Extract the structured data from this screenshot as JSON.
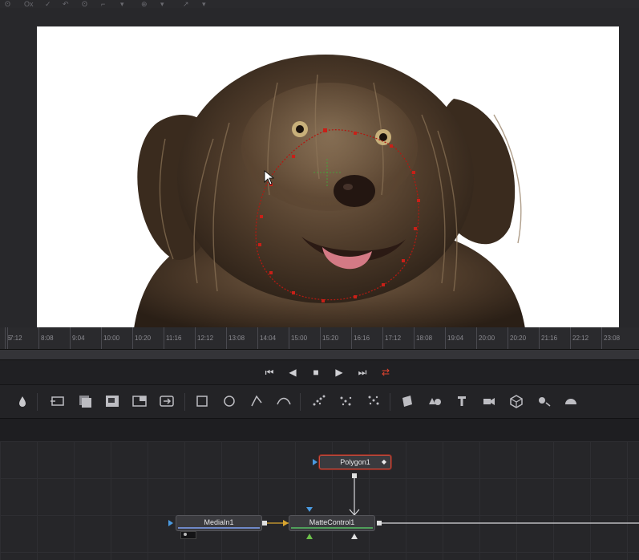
{
  "viewer": {
    "top_icons": [
      "ʘ",
      "Ox",
      "✓",
      "↶",
      "ʘ",
      "⌐",
      "▾",
      "⊕",
      "▾",
      "↗",
      "▾"
    ]
  },
  "ruler": {
    "ticks": [
      "6",
      "7:12",
      "8:08",
      "9:04",
      "10:00",
      "10:20",
      "11:16",
      "12:12",
      "13:08",
      "14:04",
      "15:00",
      "15:20",
      "16:16",
      "17:12",
      "18:08",
      "19:04",
      "20:00",
      "20:20",
      "21:16",
      "22:12",
      "23:08"
    ]
  },
  "transport": {
    "first": "⏮",
    "prev": "◀",
    "stop": "■",
    "play": "▶",
    "last": "⏭",
    "loop": "⇄"
  },
  "colors": {
    "loop_active": "#e5452f",
    "selected_node_border": "#d04a3a",
    "mediain_bar": "#6e88c8",
    "matte_bar": "#4f9e5a"
  },
  "nodes": {
    "polygon": {
      "label": "Polygon1"
    },
    "mediain": {
      "label": "MediaIn1"
    },
    "matte": {
      "label": "MatteControl1"
    }
  },
  "toolbar_icons": [
    "drop-icon",
    "loader-icon",
    "merge-icon",
    "background-icon",
    "resize-icon",
    "transform-icon",
    "rectangle-mask-icon",
    "ellipse-mask-icon",
    "polygon-mask-icon",
    "bspline-mask-icon",
    "particle-emitter-icon",
    "particle-render-icon",
    "particle-style-icon",
    "shape3d-icon",
    "merge3d-icon",
    "text3d-icon",
    "camera3d-icon",
    "renderer3d-icon",
    "light3d-icon",
    "image-plane-icon"
  ]
}
